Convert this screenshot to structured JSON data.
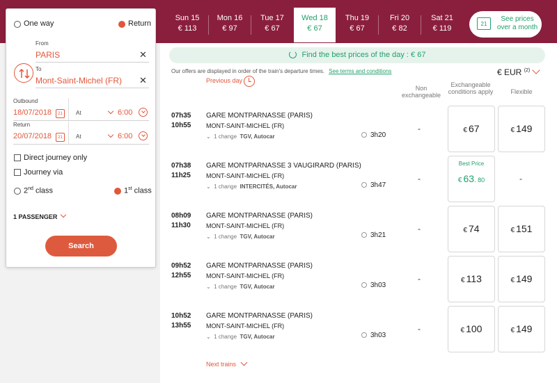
{
  "search": {
    "one_way": "One way",
    "return": "Return",
    "from_label": "From",
    "from_value": "PARIS",
    "to_label": "To",
    "to_value": "Mont-Saint-Michel (FR)",
    "outbound_label": "Outbound",
    "outbound_date": "18/07/2018",
    "return_label": "Return",
    "return_date": "20/07/2018",
    "at_label": "At",
    "outbound_time": "6:00",
    "return_time": "6:00",
    "direct_only": "Direct journey only",
    "journey_via": "Journey via",
    "class2_num": "2",
    "class2_sup": "nd",
    "class1_num": "1",
    "class1_sup": "st",
    "class_word": "class",
    "passengers": "1 PASSENGER",
    "search_button": "Search"
  },
  "dates": [
    {
      "day": "Sun 15",
      "price": "€ 113"
    },
    {
      "day": "Mon 16",
      "price": "€ 97"
    },
    {
      "day": "Tue 17",
      "price": "€ 67"
    },
    {
      "day": "Wed 18",
      "price": "€ 67"
    },
    {
      "day": "Thu 19",
      "price": "€ 67"
    },
    {
      "day": "Fri 20",
      "price": "€ 82"
    },
    {
      "day": "Sat 21",
      "price": "€ 119"
    }
  ],
  "month_prices": "See prices over a month",
  "month_cal_num": "21",
  "best_price_bar": "Find the best prices of the day : € 67",
  "offers_note": "Our offers are displayed in order of the train's departure times.",
  "terms_link": "See terms and conditions",
  "previous_day": "Previous day",
  "currency": "€ EUR",
  "currency_note": "(2)",
  "columns": {
    "non_exchangeable": "Non exchangeable",
    "exchangeable": "Exchangeable conditions apply",
    "flexible": "Flexible"
  },
  "currency_symbol": "€",
  "best_price_label": "Best Price",
  "trains": [
    {
      "dep": "07h35",
      "arr": "10h55",
      "from": "GARE MONTPARNASSE (PARIS)",
      "to": "MONT-SAINT-MICHEL (FR)",
      "changes": "1 change",
      "types": "TGV, Autocar",
      "duration": "3h20",
      "non_exch": "-",
      "exch": "67",
      "flex": "149",
      "best": false
    },
    {
      "dep": "07h38",
      "arr": "11h25",
      "from": "GARE MONTPARNASSE 3 VAUGIRARD (PARIS)",
      "to": "MONT-SAINT-MICHEL (FR)",
      "changes": "1 change",
      "types": "INTERCITÉS, Autocar",
      "duration": "3h47",
      "non_exch": "-",
      "exch": "63",
      "exch_cents": ". 80",
      "flex": "-",
      "best": true
    },
    {
      "dep": "08h09",
      "arr": "11h30",
      "from": "GARE MONTPARNASSE (PARIS)",
      "to": "MONT-SAINT-MICHEL (FR)",
      "changes": "1 change",
      "types": "TGV, Autocar",
      "duration": "3h21",
      "non_exch": "-",
      "exch": "74",
      "flex": "151",
      "best": false
    },
    {
      "dep": "09h52",
      "arr": "12h55",
      "from": "GARE MONTPARNASSE (PARIS)",
      "to": "MONT-SAINT-MICHEL (FR)",
      "changes": "1 change",
      "types": "TGV, Autocar",
      "duration": "3h03",
      "non_exch": "-",
      "exch": "113",
      "flex": "149",
      "best": false
    },
    {
      "dep": "10h52",
      "arr": "13h55",
      "from": "GARE MONTPARNASSE (PARIS)",
      "to": "MONT-SAINT-MICHEL (FR)",
      "changes": "1 change",
      "types": "TGV, Autocar",
      "duration": "3h03",
      "non_exch": "-",
      "exch": "100",
      "flex": "149",
      "best": false
    }
  ],
  "next_trains": "Next trains",
  "colors": {
    "brand": "#8a1f3d",
    "accent": "#e2573a",
    "green": "#22a06b"
  }
}
